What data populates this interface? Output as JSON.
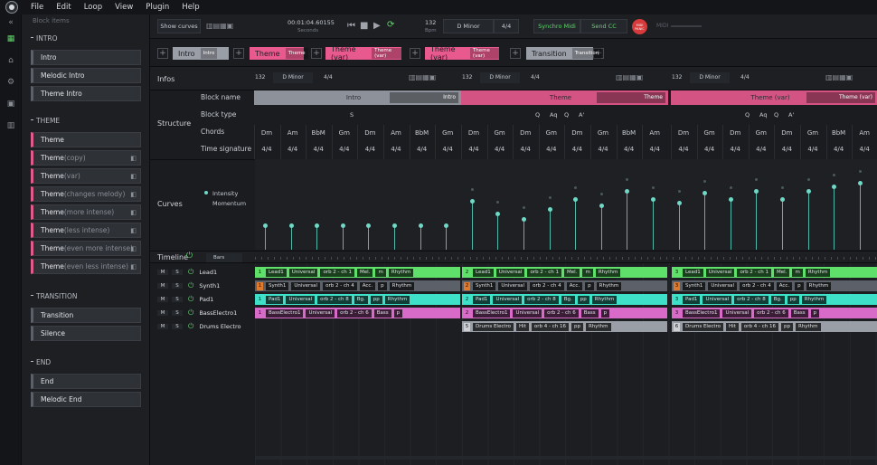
{
  "menu": {
    "items": [
      "File",
      "Edit",
      "Loop",
      "View",
      "Plugin",
      "Help"
    ]
  },
  "sidebar": {
    "header": "Block items",
    "groups": [
      {
        "title": "INTRO",
        "items": [
          {
            "label": "Intro",
            "suffix": "",
            "type": "gray"
          },
          {
            "label": "Melodic Intro",
            "suffix": "",
            "type": "gray"
          },
          {
            "label": "Theme Intro",
            "suffix": "",
            "type": "gray"
          }
        ]
      },
      {
        "title": "THEME",
        "items": [
          {
            "label": "Theme",
            "suffix": "",
            "type": "pink"
          },
          {
            "label": "Theme",
            "suffix": " (copy)",
            "type": "pink"
          },
          {
            "label": "Theme",
            "suffix": " (var)",
            "type": "pink"
          },
          {
            "label": "Theme",
            "suffix": " (changes melody)",
            "type": "pink"
          },
          {
            "label": "Theme",
            "suffix": " (more intense)",
            "type": "pink"
          },
          {
            "label": "Theme",
            "suffix": " (less intense)",
            "type": "pink"
          },
          {
            "label": "Theme",
            "suffix": " (even more intense)",
            "type": "pink"
          },
          {
            "label": "Theme",
            "suffix": " (even less intense)",
            "type": "pink"
          }
        ]
      },
      {
        "title": "TRANSITION",
        "items": [
          {
            "label": "Transition",
            "suffix": "",
            "type": "gray"
          },
          {
            "label": "Silence",
            "suffix": "",
            "type": "gray"
          }
        ]
      },
      {
        "title": "END",
        "items": [
          {
            "label": "End",
            "suffix": "",
            "type": "gray"
          },
          {
            "label": "Melodic End",
            "suffix": "",
            "type": "gray"
          }
        ]
      }
    ]
  },
  "topbar": {
    "show_curves": "Show curves",
    "time": "00:01:04.60155",
    "time_unit": "Seconds",
    "bpm": "132",
    "bpm_unit": "Bpm",
    "key": "D Minor",
    "signature": "4/4",
    "synchro_midi": "Synchro Midi",
    "send_cc": "Send CC",
    "midi_panic": "MIDI PANIC",
    "midi_label": "MIDI"
  },
  "sections": [
    {
      "label": "Intro",
      "tag": "Intro",
      "color": "#9a9ea6"
    },
    {
      "label": "Theme",
      "tag": "Theme",
      "color": "#e85a8e"
    },
    {
      "label": "Theme (var)",
      "tag": "Theme (var)",
      "color": "#e85a8e"
    },
    {
      "label": "Theme (var)",
      "tag": "Theme (var)",
      "color": "#e85a8e"
    },
    {
      "label": "Transition",
      "tag": "Transition",
      "color": "#9a9ea6"
    }
  ],
  "infos": {
    "title": "Infos",
    "blocks": [
      {
        "bpm": "132",
        "key": "D Minor",
        "sig": "4/4"
      },
      {
        "bpm": "132",
        "key": "D Minor",
        "sig": "4/4"
      },
      {
        "bpm": "132",
        "key": "D Minor",
        "sig": "4/4"
      }
    ]
  },
  "structure": {
    "title": "Structure",
    "rows": [
      "Block name",
      "Block type",
      "Chords",
      "Time signature"
    ],
    "blocks": [
      {
        "name": "Intro",
        "tag": "Intro",
        "color": "#9a9ea6",
        "types": [
          "S"
        ],
        "chords": [
          "Dm",
          "Am",
          "BbM",
          "Gm",
          "Dm",
          "Am",
          "BbM",
          "Gm"
        ]
      },
      {
        "name": "Theme",
        "tag": "Theme",
        "color": "#e85a8e",
        "types": [
          "Q",
          "Aq",
          "Q",
          "A'"
        ],
        "chords": [
          "Dm",
          "Gm",
          "Dm",
          "Gm",
          "Dm",
          "Gm",
          "BbM",
          "Am"
        ]
      },
      {
        "name": "Theme (var)",
        "tag": "Theme (var)",
        "color": "#e85a8e",
        "types": [
          "Q",
          "Aq",
          "Q",
          "A'"
        ],
        "chords": [
          "Dm",
          "Gm",
          "Dm",
          "Gm",
          "Dm",
          "Gm",
          "BbM",
          "Am"
        ]
      }
    ],
    "sig": "4/4"
  },
  "curves": {
    "title": "Curves",
    "legend": [
      "Intensity",
      "Momentum"
    ]
  },
  "timeline": {
    "title": "Timeline",
    "unit": "Bars",
    "tracks": [
      {
        "name": "Lead1"
      },
      {
        "name": "Synth1"
      },
      {
        "name": "Pad1"
      },
      {
        "name": "BassElectro1"
      },
      {
        "name": "Drums Electro"
      }
    ],
    "m": "M",
    "s": "S"
  },
  "clips": {
    "lead": [
      "Lead1",
      "Universal",
      "orb 2 - ch 1",
      "Mel.",
      "m",
      "Rhythm"
    ],
    "synth": [
      "Synth1",
      "Universal",
      "orb 2 - ch 4",
      "Acc.",
      "p",
      "Rhythm"
    ],
    "pad": [
      "Pad1",
      "Universal",
      "orb 2 - ch 8",
      "Bg.",
      "pp",
      "Rhythm"
    ],
    "bass": [
      "BassElectro1",
      "Universal",
      "orb 2 - ch 6",
      "Bass",
      "p"
    ],
    "drums": [
      "Drums Electro",
      "Hit",
      "orb 4 - ch 16",
      "pp",
      "Rhythm"
    ]
  },
  "curve_values": [
    0.3,
    0.3,
    0.3,
    0.3,
    0.3,
    0.3,
    0.3,
    0.3,
    0.6,
    0.45,
    0.38,
    0.5,
    0.62,
    0.55,
    0.72,
    0.62,
    0.58,
    0.7,
    0.62,
    0.72,
    0.62,
    0.72,
    0.78,
    0.82
  ]
}
